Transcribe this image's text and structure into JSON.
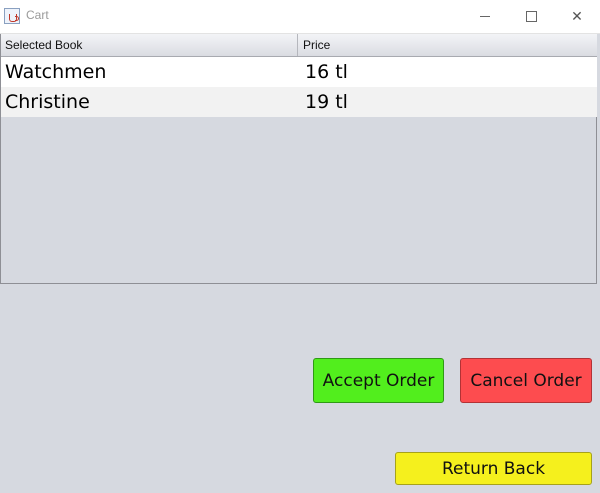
{
  "window": {
    "title": "Cart",
    "controls": {
      "minimize": "",
      "maximize": "",
      "close": "✕"
    }
  },
  "table": {
    "columns": [
      "Selected Book",
      "Price"
    ],
    "rows": [
      {
        "book": "Watchmen",
        "price": "16 tl"
      },
      {
        "book": "Christine",
        "price": "19 tl"
      }
    ]
  },
  "buttons": {
    "accept": "Accept Order",
    "cancel": "Cancel Order",
    "return": "Return Back"
  },
  "colors": {
    "accept": "#52ee1d",
    "cancel": "#fd4c4f",
    "return": "#f5f01d"
  }
}
